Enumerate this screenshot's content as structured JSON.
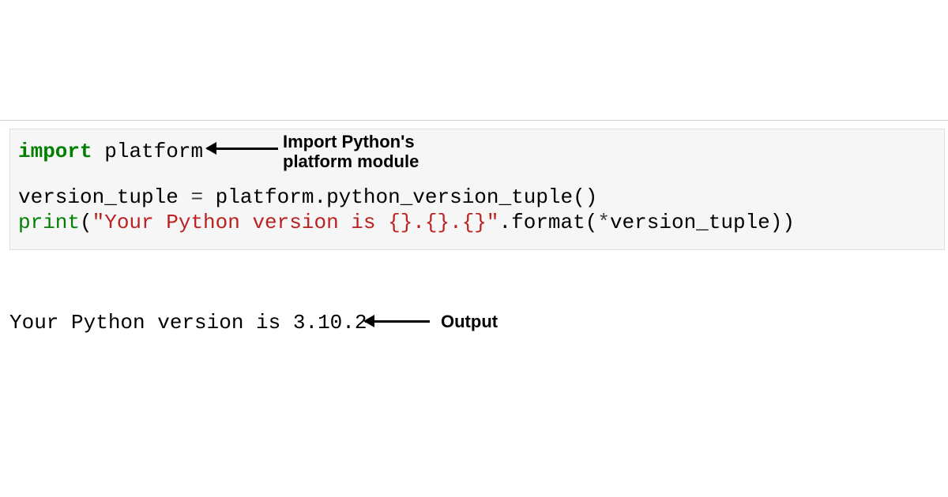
{
  "code": {
    "line1": {
      "kw": "import",
      "space": " ",
      "module": "platform"
    },
    "line2": {
      "lhs": "version_tuple ",
      "eq": "=",
      "rhs": " platform.python_version_tuple()"
    },
    "line3": {
      "fn": "print",
      "open": "(",
      "str": "\"Your Python version is {}.{}.{}\"",
      "dot": ".format(",
      "star": "*",
      "arg": "version_tuple))"
    }
  },
  "output": "Your Python version is 3.10.2",
  "annotations": {
    "import_line1": "Import Python's",
    "import_line2": "platform module",
    "output_label": "Output"
  }
}
